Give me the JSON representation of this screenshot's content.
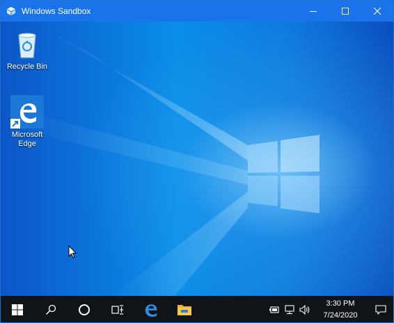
{
  "window": {
    "title": "Windows Sandbox",
    "accent": "#1a73e8"
  },
  "desktop": {
    "icons": [
      {
        "label": "Recycle Bin",
        "icon": "recycle-bin-icon"
      },
      {
        "label": "Microsoft Edge",
        "icon": "edge-icon"
      }
    ]
  },
  "taskbar": {
    "items": [
      {
        "name": "start",
        "icon": "windows-logo-icon"
      },
      {
        "name": "search",
        "icon": "search-icon"
      },
      {
        "name": "cortana",
        "icon": "circle-icon"
      },
      {
        "name": "task-view",
        "icon": "task-view-icon"
      },
      {
        "name": "edge",
        "icon": "edge-icon"
      },
      {
        "name": "file-explorer",
        "icon": "folder-icon"
      }
    ],
    "tray": {
      "icons": [
        "battery-icon",
        "network-icon",
        "volume-icon"
      ],
      "time": "3:30 PM",
      "date": "7/24/2020"
    },
    "background": "#101317"
  }
}
